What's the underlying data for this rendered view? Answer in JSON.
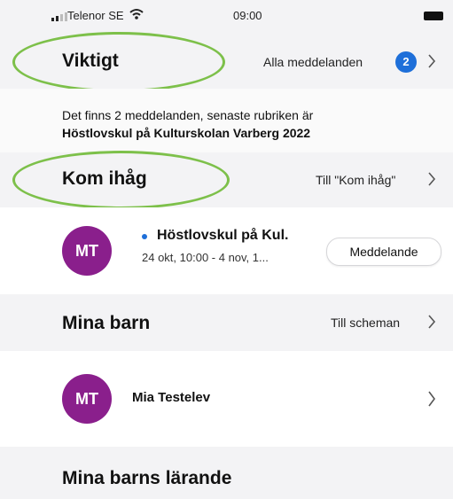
{
  "status": {
    "carrier": "Telenor SE",
    "time": "09:00"
  },
  "important": {
    "title": "Viktigt",
    "link": "Alla meddelanden",
    "badge": "2",
    "description_line1": "Det finns 2 meddelanden, senaste rubriken är",
    "description_line2": "Höstlovskul på Kulturskolan Varberg 2022"
  },
  "remember": {
    "title": "Kom ihåg",
    "link": "Till \"Kom ihåg\"",
    "item": {
      "avatar": "MT",
      "title": "Höstlovskul på Kul.",
      "subtitle": "24 okt, 10:00 - 4 nov, 1...",
      "action": "Meddelande"
    }
  },
  "children": {
    "title": "Mina barn",
    "link": "Till scheman",
    "child": {
      "avatar": "MT",
      "name": "Mia Testelev"
    }
  },
  "learning": {
    "title": "Mina barns lärande"
  },
  "colors": {
    "accent": "#1e6fd9",
    "avatar": "#8a1f8c",
    "highlight": "#7dc04a"
  }
}
